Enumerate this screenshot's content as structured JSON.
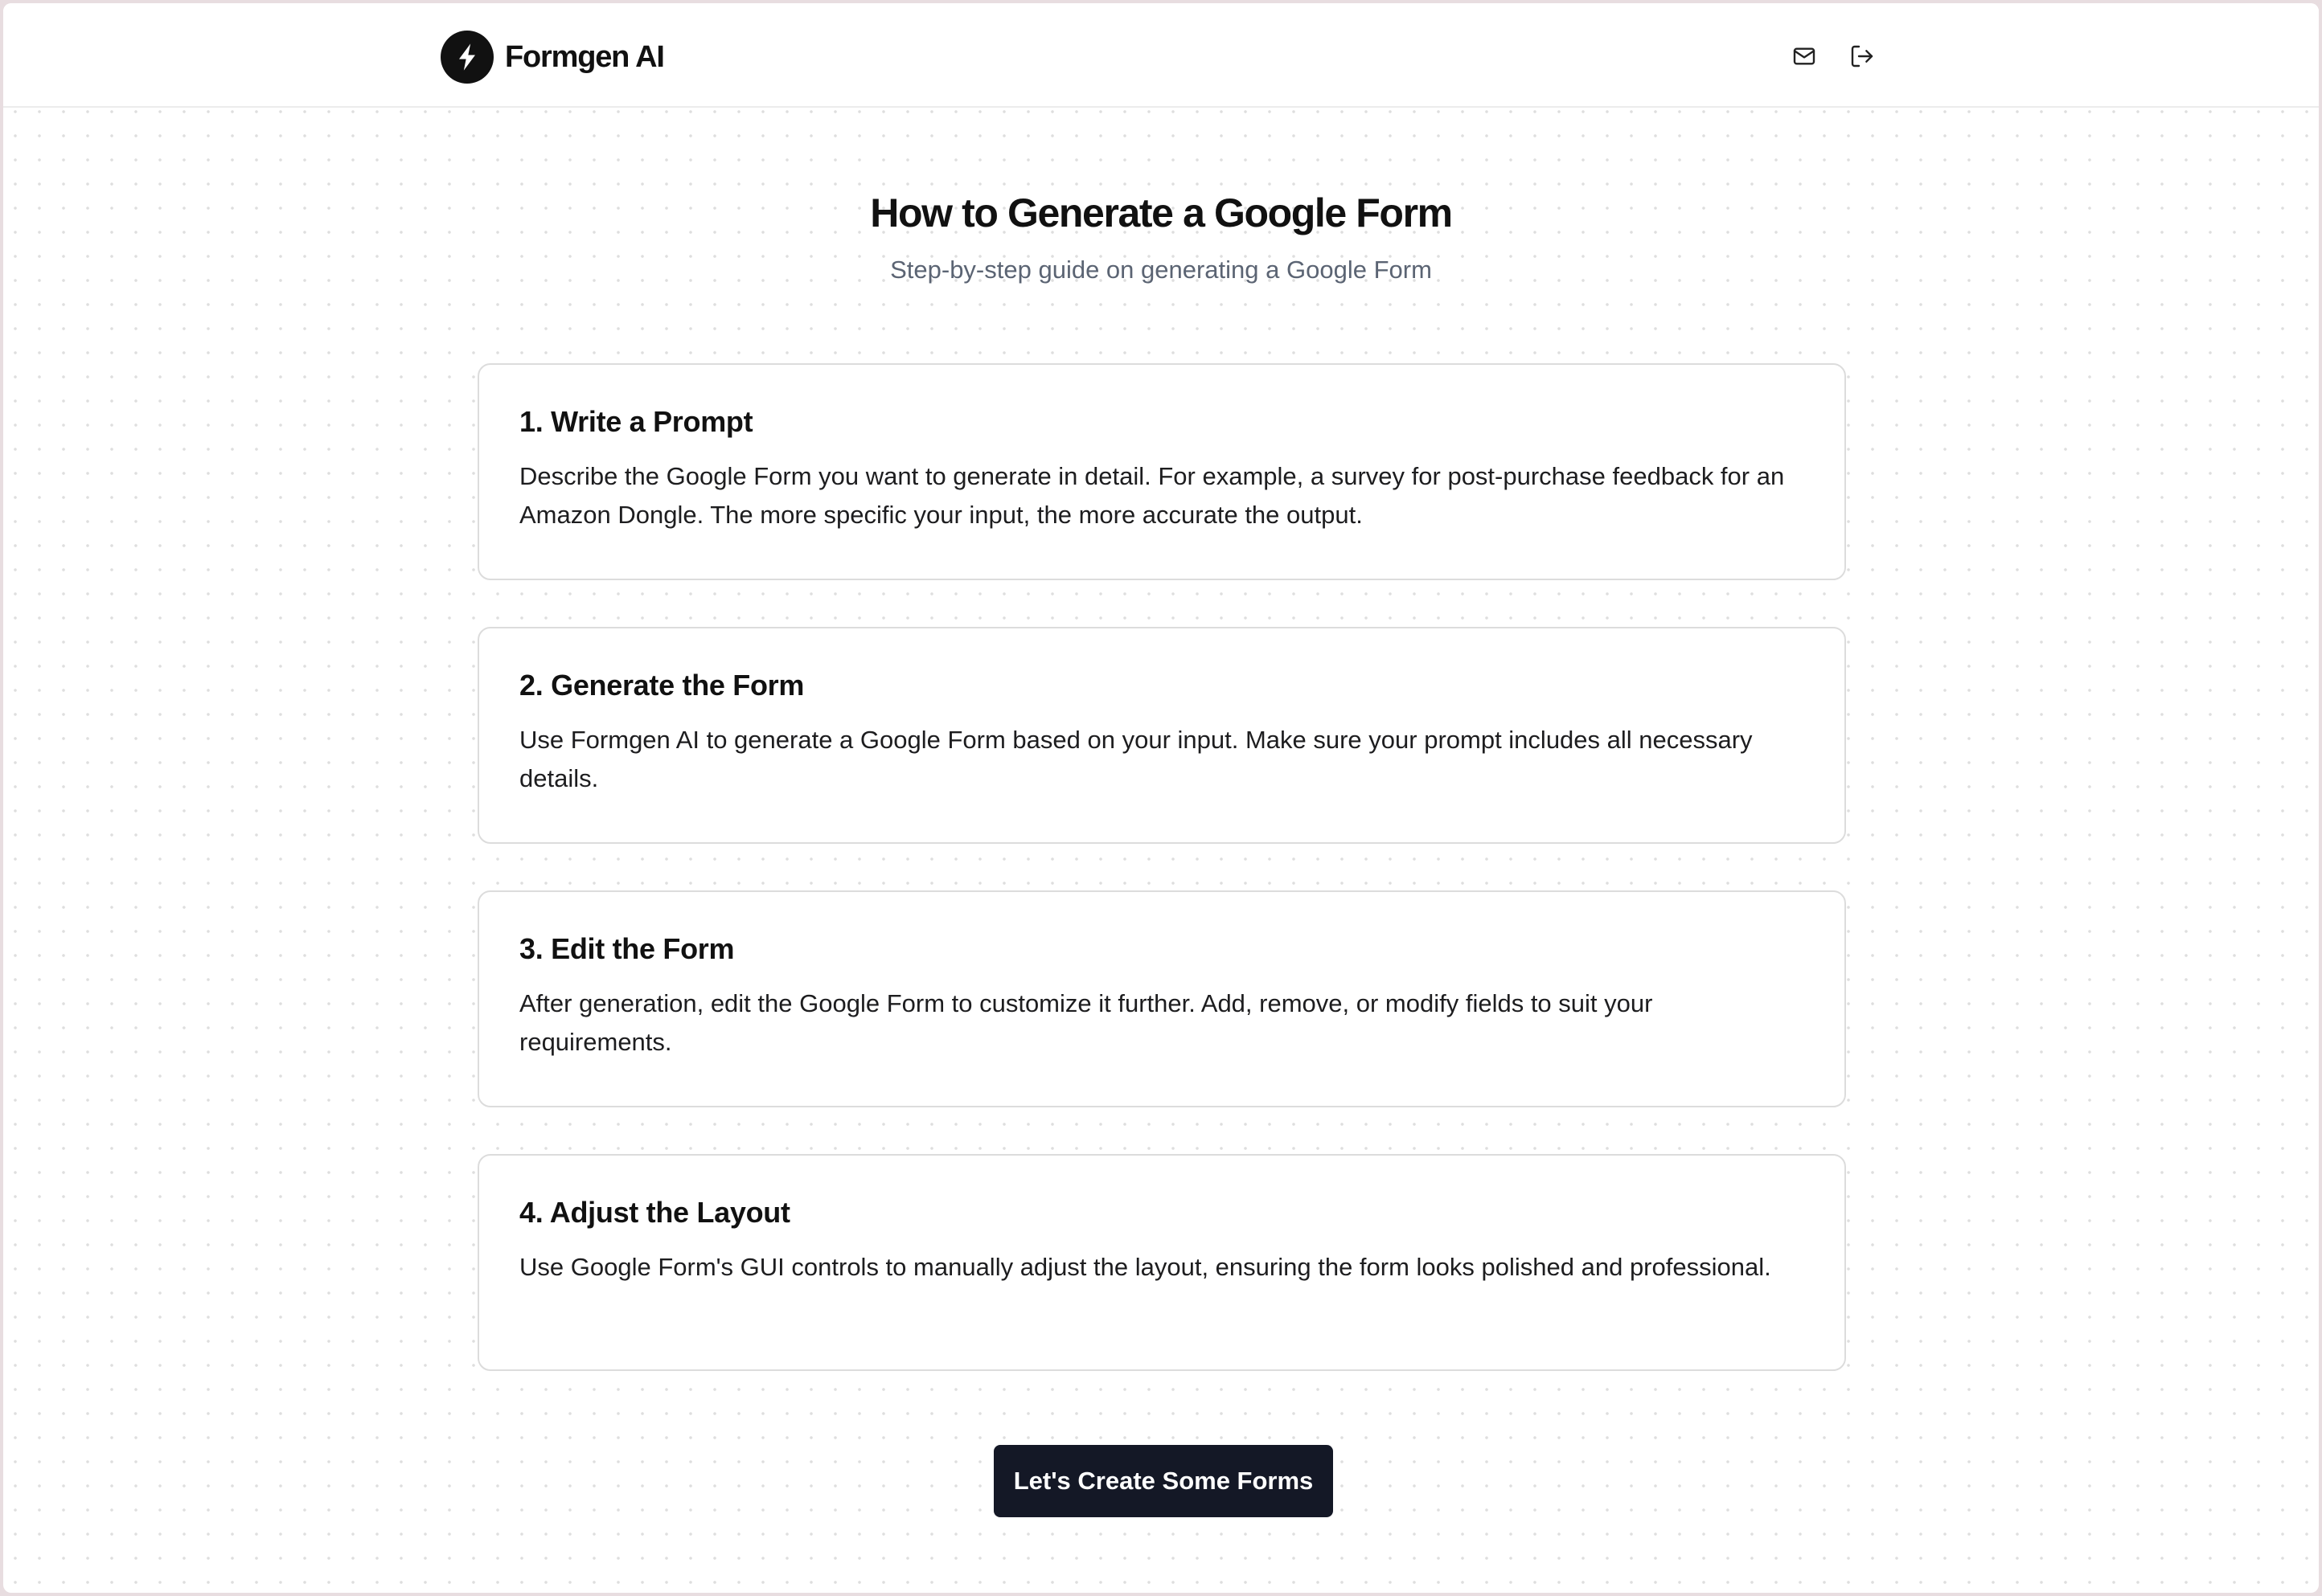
{
  "header": {
    "brand": "Formgen AI",
    "icons": {
      "logo": "bolt-icon",
      "mail": "mail-icon",
      "logout": "logout-icon"
    }
  },
  "page": {
    "title": "How to Generate a Google Form",
    "subtitle": "Step-by-step guide on generating a Google Form"
  },
  "steps": [
    {
      "title": "1. Write a Prompt",
      "text": "Describe the Google Form you want to generate in detail. For example, a survey for post-purchase feedback for an Amazon Dongle. The more specific your input, the more accurate the output."
    },
    {
      "title": "2. Generate the Form",
      "text": "Use Formgen AI to generate a Google Form based on your input. Make sure your prompt includes all necessary details."
    },
    {
      "title": "3. Edit the Form",
      "text": "After generation, edit the Google Form to customize it further. Add, remove, or modify fields to suit your requirements."
    },
    {
      "title": "4. Adjust the Layout",
      "text": "Use Google Form's GUI controls to manually adjust the layout, ensuring the form looks polished and professional."
    }
  ],
  "cta": {
    "label": "Let's Create Some Forms"
  },
  "colors": {
    "primary_button": "#141826",
    "subtitle": "#5b6473",
    "card_border": "#dcdcdc"
  }
}
